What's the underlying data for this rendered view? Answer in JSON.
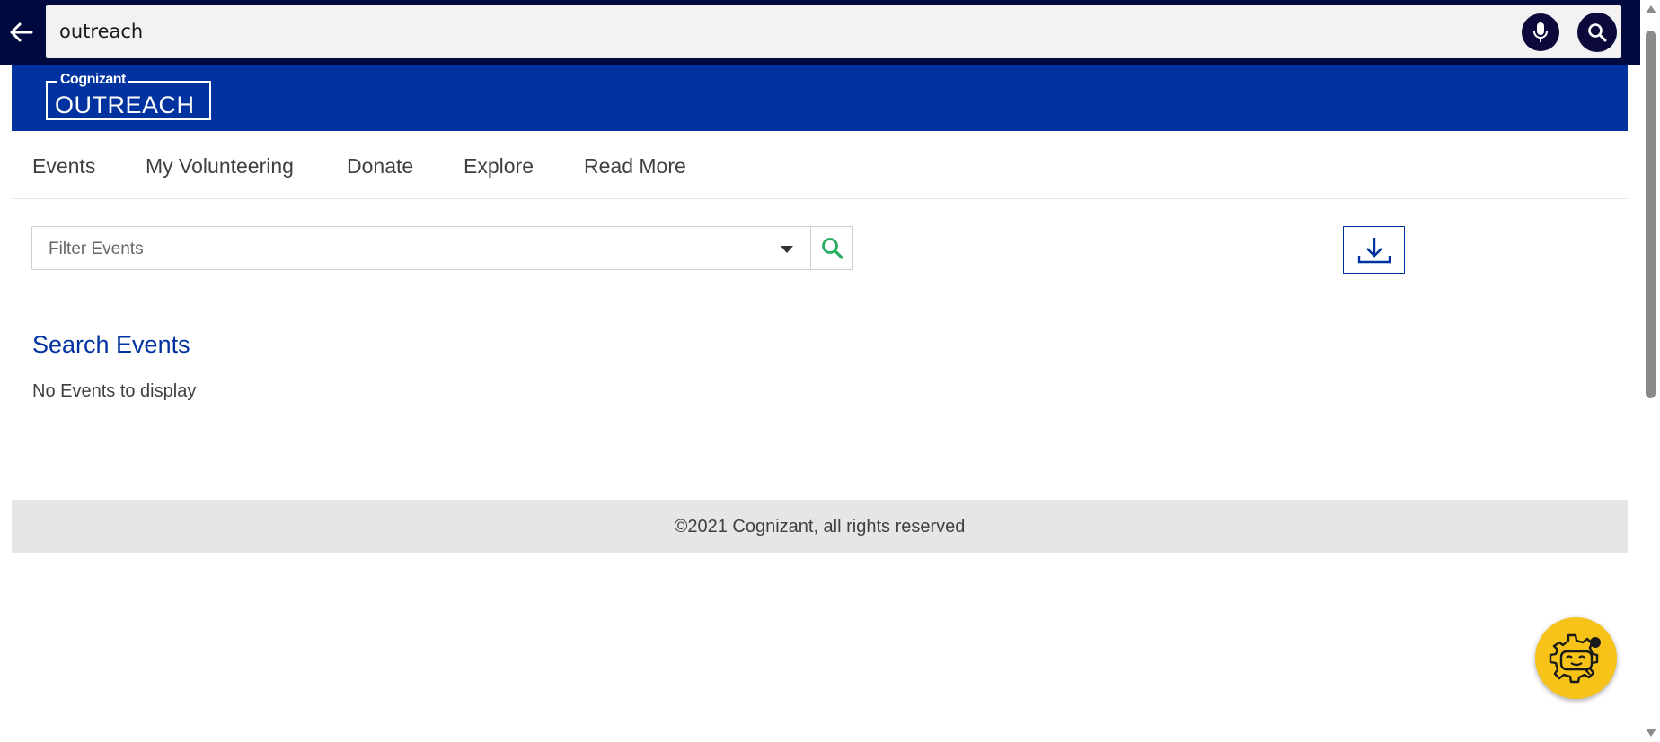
{
  "search_bar": {
    "query": "outreach",
    "back_icon": "arrow-left-icon",
    "mic_icon": "microphone-icon",
    "search_icon": "search-icon"
  },
  "brand": {
    "logo_top": "Cognizant",
    "logo_main": "OUTREACH",
    "header_color": "#0033a0"
  },
  "nav": {
    "items": [
      {
        "label": "Events"
      },
      {
        "label": "My Volunteering"
      },
      {
        "label": "Donate"
      },
      {
        "label": "Explore"
      },
      {
        "label": "Read More"
      }
    ]
  },
  "filter": {
    "placeholder": "Filter Events",
    "search_icon": "search-icon",
    "download_icon": "download-icon"
  },
  "main": {
    "section_title": "Search Events",
    "empty_message": "No Events to display"
  },
  "footer": {
    "text": "©2021 Cognizant, all rights reserved"
  },
  "chatbot": {
    "icon": "chatbot-icon",
    "color": "#f7c318"
  }
}
